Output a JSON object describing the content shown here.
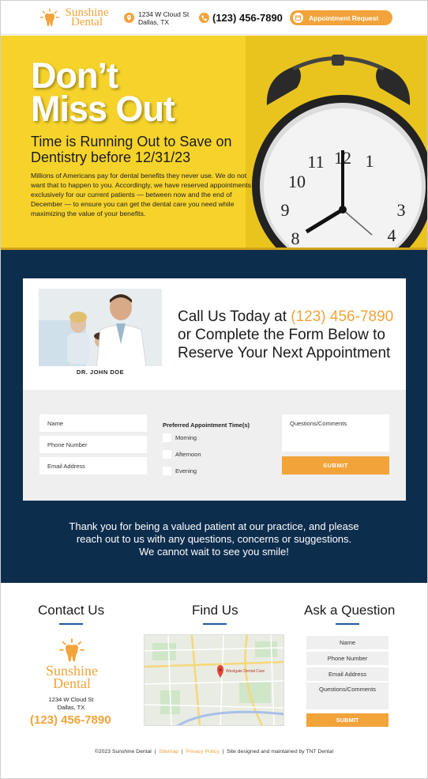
{
  "header": {
    "brand_line1": "Sunshine",
    "brand_line2": "Dental",
    "address_line1": "1234 W Cloud St",
    "address_line2": "Dallas, TX",
    "phone": "(123) 456-7890",
    "appointment_label": "Appointment Request"
  },
  "hero": {
    "headline_line1": "Don’t",
    "headline_line2": "Miss Out",
    "subhead": "Time is Running Out to Save on Dentistry before 12/31/23",
    "body": "Millions of Americans pay for dental benefits they never use. We do not want that to happen to you. Accordingly, we have reserved appointments exclusively for our current patients — between now and the end of December — to ensure you can get the dental care you need while maximizing the value of your benefits.",
    "clock_numerals": [
      "12",
      "1",
      "11",
      "10",
      "9",
      "3",
      "8",
      "4"
    ]
  },
  "contact_card": {
    "doctor_name": "DR. JOHN DOE",
    "call_prefix": "Call Us Today at ",
    "call_phone": "(123) 456-7890",
    "call_rest": "or Complete the Form Below to Reserve Your Next Appointment"
  },
  "form": {
    "name_placeholder": "Name",
    "phone_placeholder": "Phone Number",
    "email_placeholder": "Email Address",
    "pref_label": "Preferred Appointment Time(s)",
    "options": [
      "Morning",
      "Afternoon",
      "Evening"
    ],
    "comments_placeholder": "Questions/Comments",
    "submit_label": "SUBMIT"
  },
  "thanks": {
    "line1": "Thank you for being a valued patient at our practice, and please",
    "line2": "reach out to us with any questions, concerns or suggestions.",
    "line3": "We cannot wait to see you smile!"
  },
  "footer": {
    "contact_heading": "Contact Us",
    "find_heading": "Find Us",
    "ask_heading": "Ask a Question",
    "brand_line1": "Sunshine",
    "brand_line2": "Dental",
    "address_line1": "1234 W Cloud St",
    "address_line2": "Dallas, TX",
    "phone": "(123) 456-7890",
    "map_pin_label": "Westgate Dental Care",
    "ask_fields": [
      "Name",
      "Phone Number",
      "Email Address",
      "Questions/Comments"
    ],
    "ask_submit": "SUBMIT",
    "copyright": "©2023 Sunshine Dental",
    "sitemap": "Sitemap",
    "privacy": "Privacy Policy",
    "credit": "Site designed and maintained by TNT Dental"
  },
  "colors": {
    "accent": "#f2a33a",
    "hero_yellow": "#f6d32b",
    "navy": "#0d2d4d",
    "underline_blue": "#1d5b9a"
  }
}
